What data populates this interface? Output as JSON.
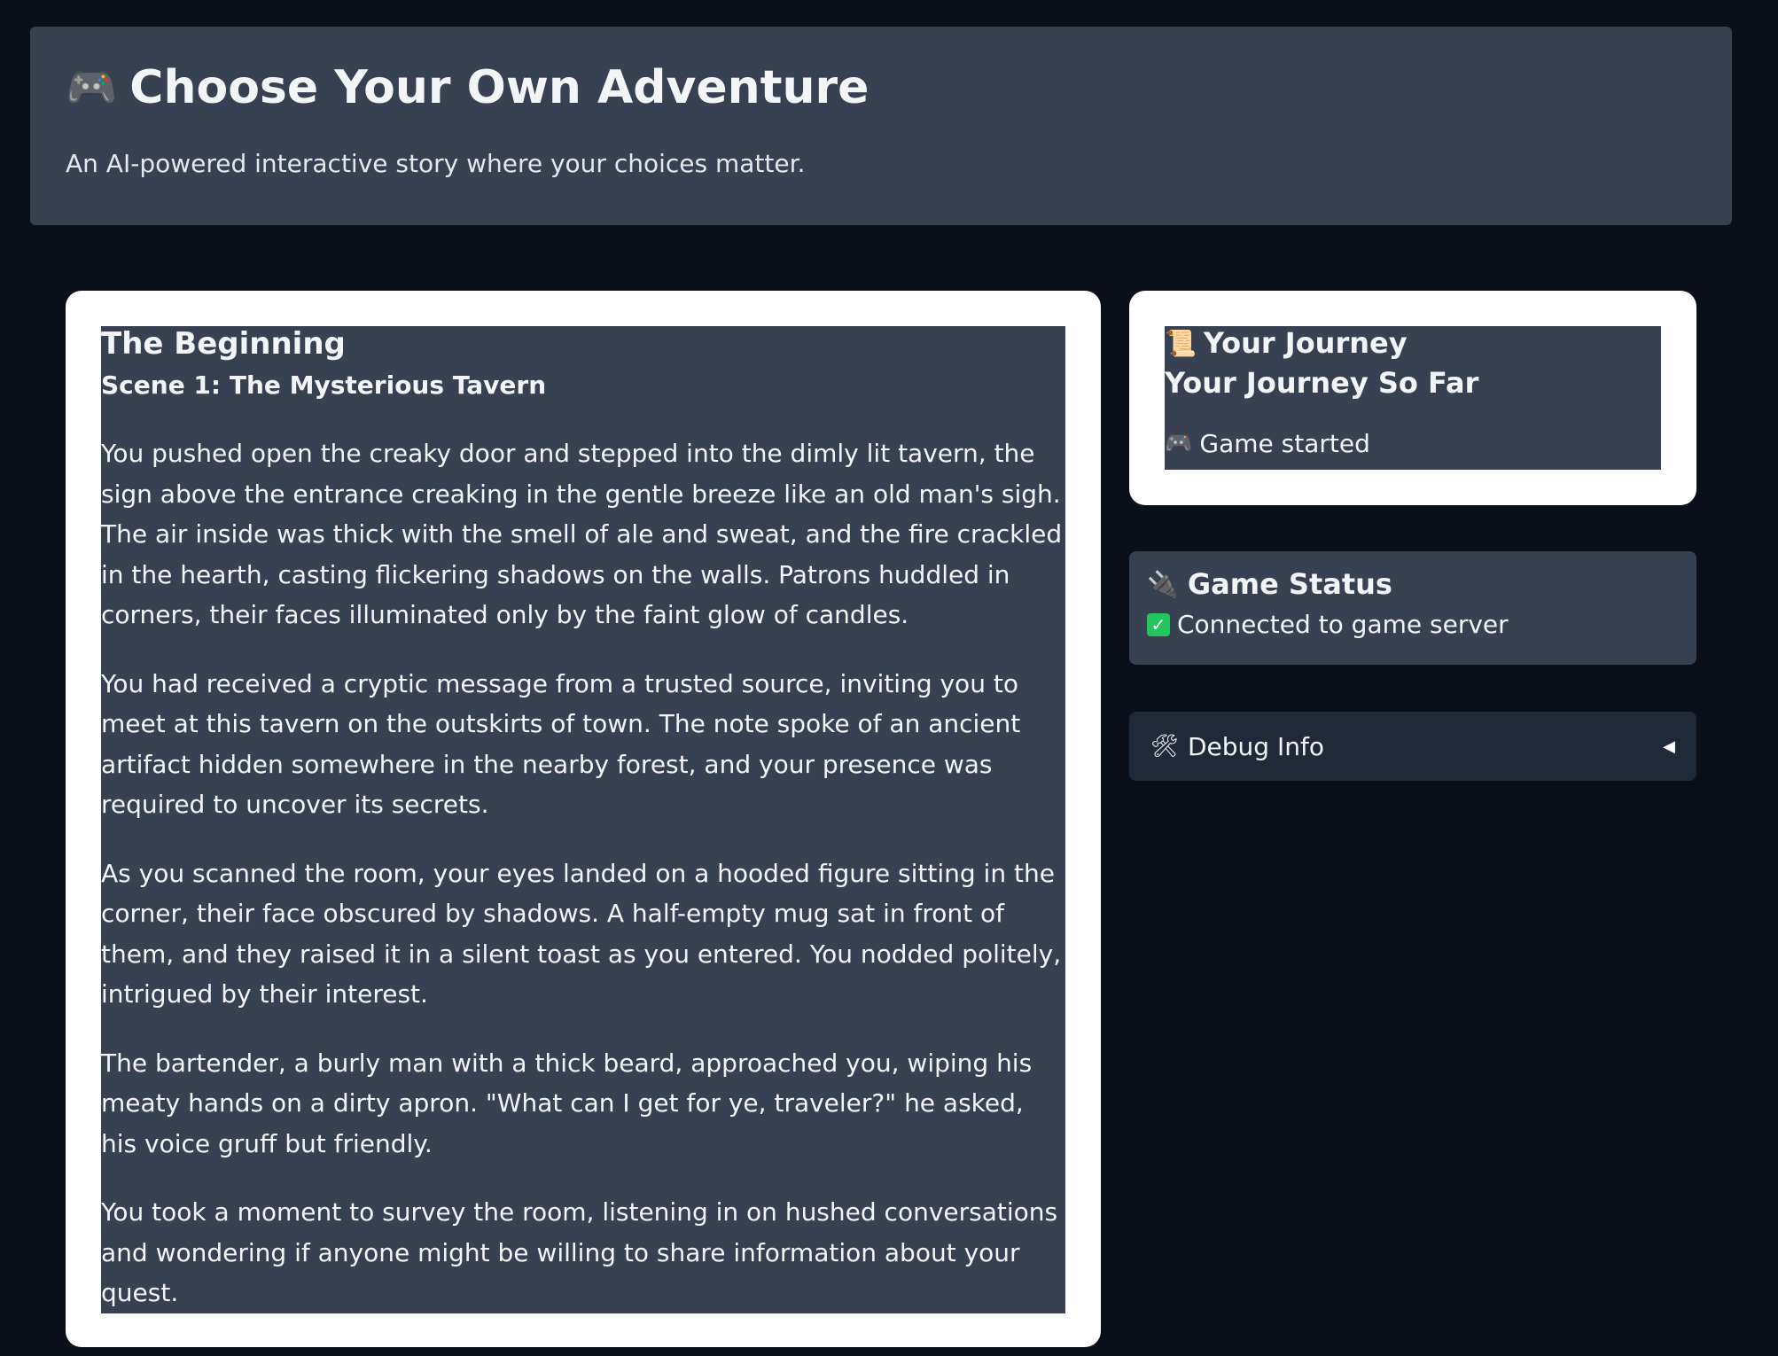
{
  "header": {
    "icon": "game-controller-icon",
    "title_emoji": "🎮",
    "title": "Choose Your Own Adventure",
    "subtitle": "An AI-powered interactive story where your choices matter."
  },
  "story": {
    "title": "The Beginning",
    "scene": "Scene 1: The Mysterious Tavern",
    "paragraphs": [
      "You pushed open the creaky door and stepped into the dimly lit tavern, the sign above the entrance creaking in the gentle breeze like an old man's sigh. The air inside was thick with the smell of ale and sweat, and the fire crackled in the hearth, casting flickering shadows on the walls. Patrons huddled in corners, their faces illuminated only by the faint glow of candles.",
      "You had received a cryptic message from a trusted source, inviting you to meet at this tavern on the outskirts of town. The note spoke of an ancient artifact hidden somewhere in the nearby forest, and your presence was required to uncover its secrets.",
      "As you scanned the room, your eyes landed on a hooded figure sitting in the corner, their face obscured by shadows. A half-empty mug sat in front of them, and they raised it in a silent toast as you entered. You nodded politely, intrigued by their interest.",
      "The bartender, a burly man with a thick beard, approached you, wiping his meaty hands on a dirty apron. \"What can I get for ye, traveler?\" he asked, his voice gruff but friendly.",
      "You took a moment to survey the room, listening in on hushed conversations and wondering if anyone might be willing to share information about your quest."
    ]
  },
  "journey": {
    "icon": "scroll-icon",
    "icon_emoji": "📜",
    "title": "Your Journey",
    "subtitle": "Your Journey So Far",
    "items": [
      {
        "icon": "game-controller-icon",
        "emoji": "🎮",
        "text": "Game started"
      }
    ]
  },
  "status": {
    "icon": "plug-icon",
    "icon_emoji": "🔌",
    "title": "Game Status",
    "check": "✓",
    "text": "Connected to game server"
  },
  "debug": {
    "icon": "tools-icon",
    "icon_emoji": "🛠",
    "label": "Debug Info",
    "caret": "◀"
  }
}
